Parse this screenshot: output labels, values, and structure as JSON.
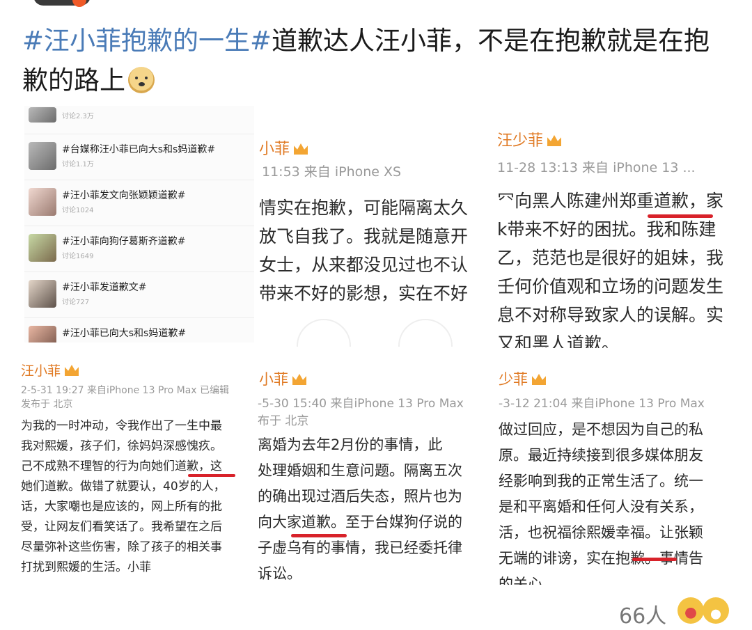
{
  "post": {
    "hashtag": "#汪小菲抱歉的一生#",
    "text": "道歉达人汪小菲，不是在抱歉就是在抱歉的路上",
    "emoji_icon": "doge-icon"
  },
  "topics": [
    {
      "title": "",
      "sub": "讨论2.3万"
    },
    {
      "title": "#台媒称汪小菲已向大s和s妈道歉#",
      "sub": "讨论1.1万"
    },
    {
      "title": "#汪小菲发文向张颖颖道歉#",
      "sub": "讨论1024"
    },
    {
      "title": "#汪小菲向狗仔葛斯齐道歉#",
      "sub": "讨论1649"
    },
    {
      "title": "#汪小菲发道歉文#",
      "sub": "讨论727"
    },
    {
      "title": "#汪小菲已向大s和s妈道歉#",
      "sub": ""
    }
  ],
  "panel2": {
    "name": "小菲",
    "meta": "11:53  来自 iPhone XS",
    "lines": [
      "情实在抱歉，可能隔离太久",
      "放飞自我了。我就是随意开",
      "女士，从来都没见过也不认",
      "带来不好的影想，实在不好"
    ]
  },
  "panel3": {
    "name": "汪少菲",
    "meta": "11-28 13:13  来自 iPhone 13 ...",
    "lines": [
      "⺳向黑人陈建州郑重道歉，家",
      "k带来不好的困扰。我和陈建",
      "乙，范范也是很好的姐妹，我",
      "壬何价值观和立场的问题发生",
      "息不对称导致家人的误解。实",
      "又和黑人道歉。"
    ]
  },
  "panel4": {
    "name": "汪小菲",
    "meta": "2-5-31 19:27  来自iPhone 13 Pro Max  已编辑",
    "loc": "发布于 北京",
    "lines": [
      "为我的一时冲动，令我作出了一生中最",
      " 我对熙媛，孩子们，徐妈妈深感愧疚。",
      "己不成熟不理智的行为向她们道歉，这",
      "她们道歉。做错了就要认，40岁的人，",
      "话，大家嘲也是应该的，网上所有的批",
      "受，让网友们看笑话了。我希望在之后",
      "尽量弥补这些伤害，除了孩子的相关事",
      "打扰到熙媛的生活。小菲"
    ]
  },
  "panel5": {
    "name": "小菲",
    "meta": "-5-30 15:40  来自iPhone 13 Pro Max",
    "loc": "布于 北京",
    "lines": [
      "离婚为去年2月份的事情，此",
      "处理婚姻和生意问题。隔离五次",
      "的确出现过酒后失态，照片也为",
      "向大家道歉。至于台媒狗仔说的",
      "子虚乌有的事情，我已经委托律",
      "诉讼。"
    ]
  },
  "panel6": {
    "name": "少菲",
    "meta": "-3-12 21:04  来自iPhone 13 Pro Max",
    "lines": [
      "做过回应，是不想因为自己的私",
      "原。最近持续接到很多媒体朋友",
      "经影响到我的正常生活了。统一",
      "是和平离婚和任何人没有关系，",
      "活，也祝福徐熙媛幸福。让张颖",
      "无端的诽谤，实在抱歉。事情告",
      "的关心"
    ]
  },
  "footer": {
    "count": "66人",
    "emoji_icons": [
      "laugh-cry-icon",
      "grin-icon"
    ]
  },
  "colors": {
    "hashtag": "#4a7bb7",
    "username": "#e07a24",
    "underline": "#d8222a"
  }
}
